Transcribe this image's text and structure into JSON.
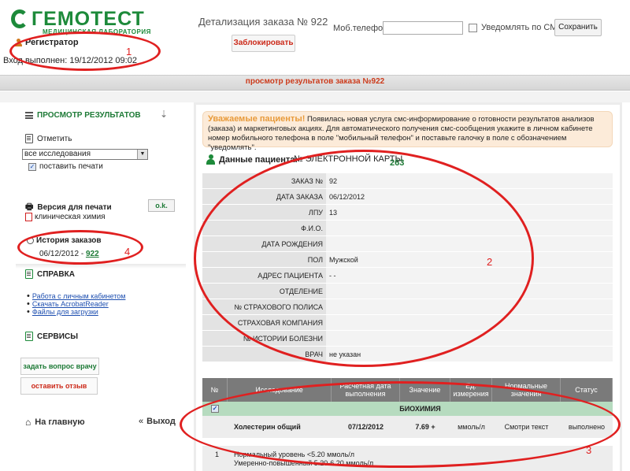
{
  "header": {
    "logo_text": "ГЕМОТЕСТ",
    "logo_sub": "МЕДИЦИНСКАЯ ЛАБОРАТОРИЯ",
    "user_role": "Регистратор",
    "login_info": "Вход выполнен: 19/12/2012 09:02",
    "order_title": "Детализация заказа № 922",
    "block_label": "Заблокировать",
    "phone_label": "Моб.телефон:",
    "phone_value": "",
    "sms_label": "Уведомлять по СМС",
    "save_label": "Сохранить"
  },
  "bar": {
    "title": "просмотр результатов заказа №922"
  },
  "sidebar": {
    "results_head": "ПРОСМОТР РЕЗУЛЬТАТОВ",
    "mark_head": "Отметить",
    "select_value": "все исследования",
    "print_check_label": "поставить печати",
    "print_version": "Версия для печати",
    "ok_label": "o.k.",
    "clinical": "клиническая химия",
    "history_head": "История заказов",
    "history_date": "06/12/2012 -",
    "history_link": "922",
    "help_head": "СПРАВКА",
    "help_links": [
      "Работа с личным кабинетом",
      "Скачать AcrobatReader",
      "Файлы для загрузки"
    ],
    "services_head": "СЕРВИСЫ",
    "ask_doctor": "задать вопрос врачу",
    "feedback": "оставить отзыв",
    "home": "На главную",
    "exit": "Выход"
  },
  "notice": {
    "head": "Уважаемые пациенты!",
    "text": "Появилась новая услуга смс-информирование о готовности результатов анализов (заказа) и маркетинговых акциях. Для автоматического получения смс-сообщения укажите в личном кабинете номер мобильного телефона в поле \"мобильный телефон\" и поставьте галочку в поле с обозначением \"уведомлять\"."
  },
  "patient": {
    "head": "Данные пациента:",
    "card_label": "№ ЭЛЕКТРОННОЙ КАРТЫ",
    "card_value": "263",
    "rows": [
      {
        "label": "ЗАКАЗ №",
        "value": "92"
      },
      {
        "label": "ДАТА ЗАКАЗА",
        "value": "06/12/2012"
      },
      {
        "label": "ЛПУ",
        "value": "13"
      },
      {
        "label": "Ф.И.О.",
        "value": ""
      },
      {
        "label": "ДАТА РОЖДЕНИЯ",
        "value": ""
      },
      {
        "label": "ПОЛ",
        "value": "Мужской"
      },
      {
        "label": "АДРЕС ПАЦИЕНТА",
        "value": "- -"
      },
      {
        "label": "ОТДЕЛЕНИЕ",
        "value": ""
      },
      {
        "label": "№ СТРАХОВОГО ПОЛИСА",
        "value": ""
      },
      {
        "label": "СТРАХОВАЯ КОМПАНИЯ",
        "value": ""
      },
      {
        "label": "№ ИСТОРИИ БОЛЕЗНИ",
        "value": ""
      },
      {
        "label": "ВРАЧ",
        "value": "не указан"
      }
    ]
  },
  "results": {
    "headers": [
      "№",
      "Исследование",
      "Расчетная дата выполнения",
      "Значение",
      "Ед. измерения",
      "Нормальные значения",
      "Статус"
    ],
    "section": "БИОХИМИЯ",
    "row": {
      "name": "Холестерин общий",
      "date": "07/12/2012",
      "value": "7.69 +",
      "unit": "ммоль/л",
      "norm": "Смотри текст",
      "status": "выполнено",
      "num": "1"
    },
    "norms": [
      "Нормальный уровень <5.20 ммоль/л",
      "Умеренно-повышенный 5.20-6.20 ммоль/л"
    ]
  },
  "annotations": [
    "1",
    "2",
    "3",
    "4"
  ],
  "colors": {
    "accent_green": "#1d8a3a",
    "annotation_red": "#e02020",
    "bar_title": "#cc3a1a"
  }
}
